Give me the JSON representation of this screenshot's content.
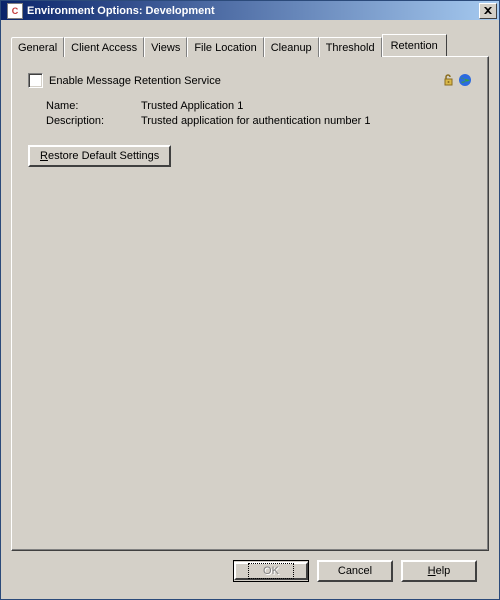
{
  "window": {
    "title": "Environment Options:  Development"
  },
  "tabs": {
    "active_index": 6,
    "items": [
      "General",
      "Client Access",
      "Views",
      "File Location",
      "Cleanup",
      "Threshold",
      "Retention"
    ]
  },
  "retention": {
    "checkbox_label": "Enable Message Retention Service",
    "name_label": "Name:",
    "name_value": "Trusted Application 1",
    "description_label": "Description:",
    "description_value": "Trusted application for authentication number 1",
    "restore_button": "Restore Default Settings",
    "restore_button_prefix": "R",
    "restore_button_rest": "estore Default Settings"
  },
  "icons": {
    "padlock": "padlock-icon"
  },
  "buttons": {
    "ok": "OK",
    "cancel": "Cancel",
    "help_prefix": "H",
    "help_rest": "elp"
  }
}
